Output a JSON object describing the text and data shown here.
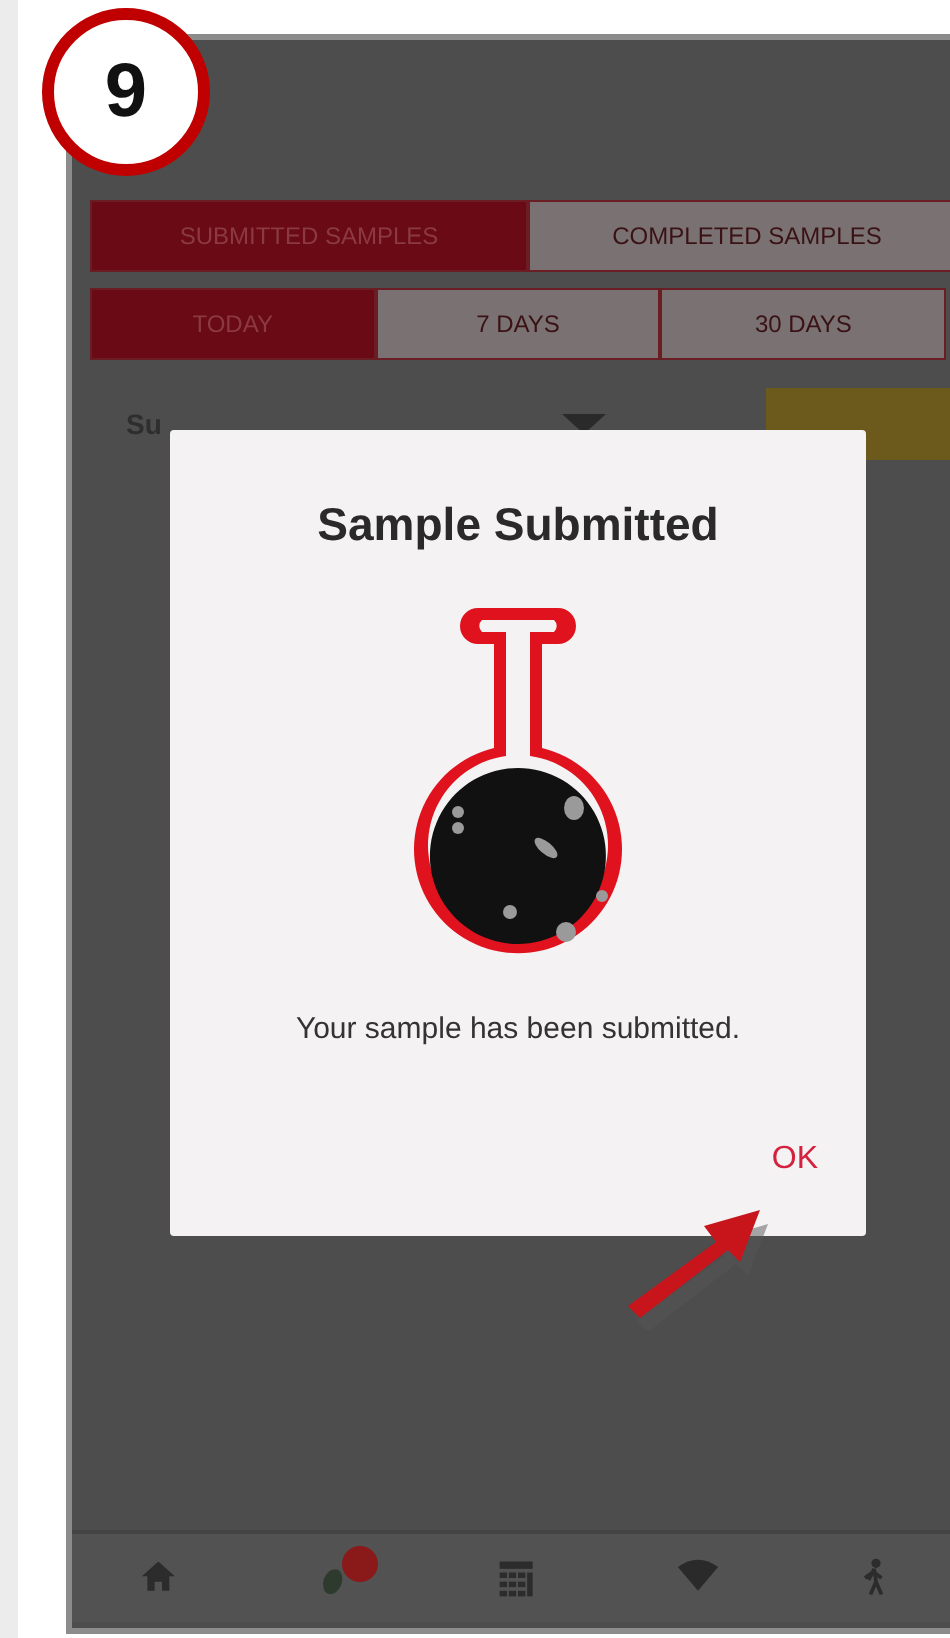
{
  "step_badge": "9",
  "tabs": [
    {
      "label": "SUBMITTED SAMPLES",
      "selected": true
    },
    {
      "label": "COMPLETED SAMPLES",
      "selected": false
    }
  ],
  "periods": [
    {
      "label": "TODAY",
      "selected": true
    },
    {
      "label": "7 DAYS",
      "selected": false
    },
    {
      "label": "30 DAYS",
      "selected": false
    }
  ],
  "filter": {
    "value": "Su"
  },
  "dialog": {
    "title": "Sample Submitted",
    "message": "Your sample has been submitted.",
    "button": "OK"
  },
  "bottom_nav": [
    {
      "kind": "home",
      "badge": false
    },
    {
      "kind": "pills",
      "badge": true
    },
    {
      "kind": "calendar",
      "badge": false
    },
    {
      "kind": "wifi",
      "badge": false
    },
    {
      "kind": "walk",
      "badge": false
    }
  ]
}
